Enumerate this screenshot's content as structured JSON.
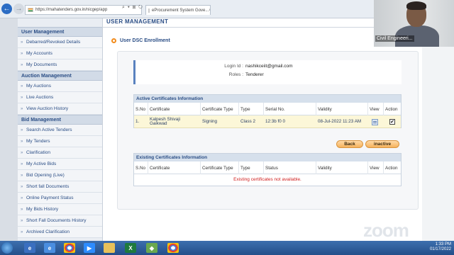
{
  "browser": {
    "url": "https://mahatenders.gov.in/nicgep/app",
    "tab_title": "eProcurement System Gove...",
    "tab_close": "×",
    "address_tools": "⌕ ▾ ⊠ ↻"
  },
  "sidebar": {
    "sections": [
      {
        "title": "User Management",
        "items": [
          "Debarred/Revoked Details",
          "My Accounts",
          "My Documents"
        ]
      },
      {
        "title": "Auction Management",
        "items": [
          "My Auctions",
          "Live Auctions",
          "View Auction History"
        ]
      },
      {
        "title": "Bid Management",
        "items": [
          "Search Active Tenders",
          "My Tenders",
          "Clarification",
          "My Active Bids",
          "Bid Opening (Live)",
          "Short fall Documents",
          "Online Payment Status",
          "My Bids History",
          "Short Fall Documents History",
          "Archived Clarification"
        ]
      }
    ]
  },
  "main": {
    "title": "USER MANAGEMENT",
    "subtitle": "User DSC Enrollment",
    "login_id_label": "Login Id :",
    "login_id_value": "nashikceiit@gmail.com",
    "roles_label": "Roles :",
    "roles_value": "Tenderer",
    "active": {
      "heading": "Active Certificates Information",
      "columns": [
        "S.No",
        "Certificate",
        "Certificate Type",
        "Type",
        "Serial No.",
        "Validity",
        "View",
        "Action"
      ],
      "rows": [
        {
          "sno": "1.",
          "certificate": "Kalpesh Shivaji Gaikwad",
          "cert_type": "Signing",
          "type": "Class 2",
          "serial": "12:3b f0 0",
          "validity": "08-Jul-2022 11:23 AM",
          "action_checked": "✔"
        }
      ]
    },
    "buttons": {
      "back": "Back",
      "inactive": "inactive"
    },
    "existing": {
      "heading": "Existing Certificates Information",
      "columns": [
        "S.No",
        "Certificate",
        "Certificate Type",
        "Type",
        "Status",
        "Validity",
        "View",
        "Action"
      ],
      "empty_message": "Existing certificates not available."
    }
  },
  "video": {
    "participant_name": "Civil Engineeri..."
  },
  "watermark": "zoom",
  "taskbar": {
    "time": "1:33 PM",
    "date": "01/17/2022",
    "icons": [
      "ie-icon",
      "chrome-icon",
      "zoom-icon",
      "folder-icon",
      "excel-icon",
      "paint-icon",
      "chrome-icon"
    ]
  }
}
